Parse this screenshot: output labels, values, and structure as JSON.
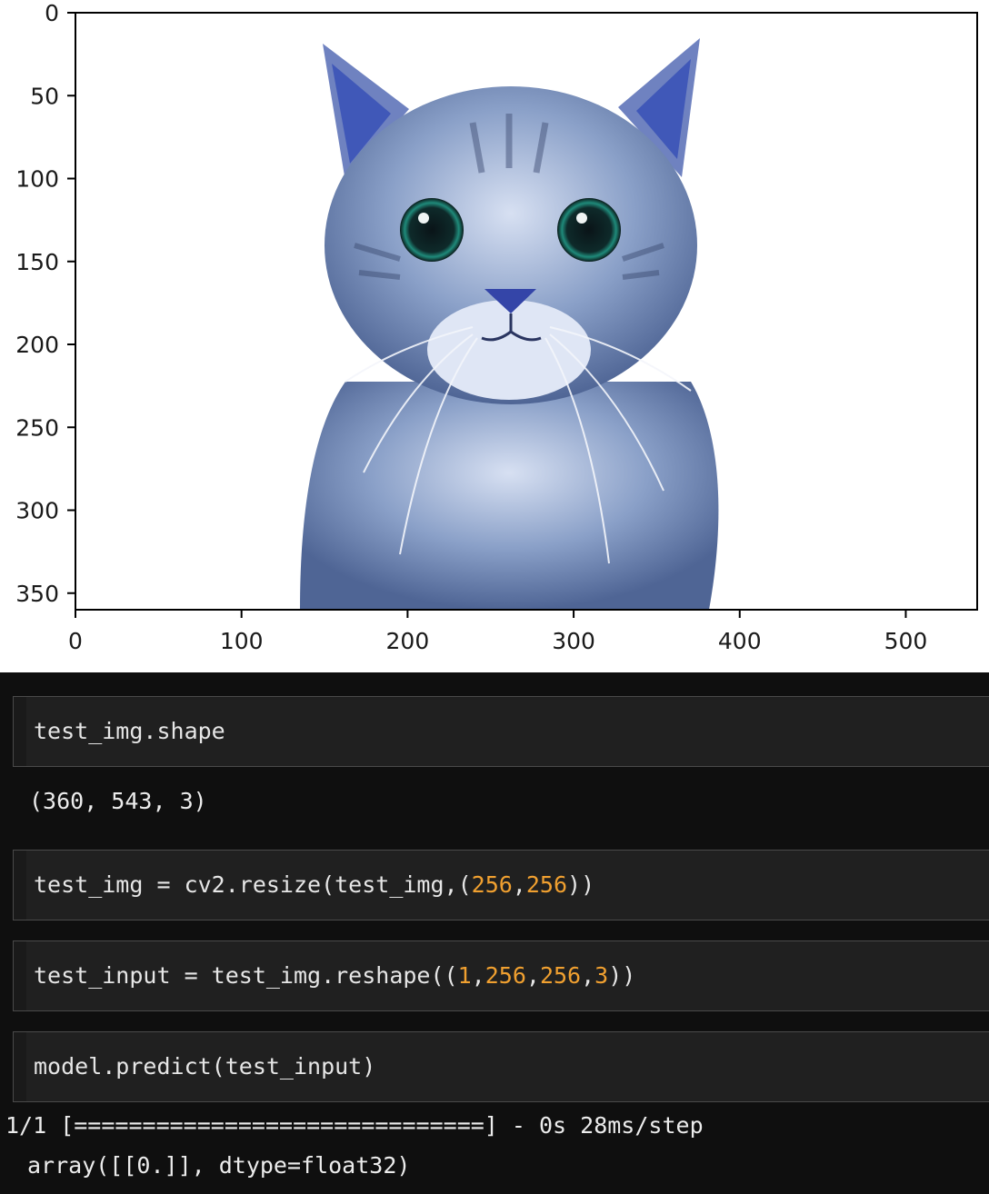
{
  "plot": {
    "x_ticks": [
      "0",
      "100",
      "200",
      "300",
      "400",
      "500"
    ],
    "y_ticks": [
      "0",
      "50",
      "100",
      "150",
      "200",
      "250",
      "300",
      "350"
    ],
    "image_subject": "cat photograph"
  },
  "colors": {
    "notebook_bg": "#0f0f0f",
    "cell_bg": "#202020",
    "number_literal": "#f0a030"
  },
  "cells": [
    {
      "segments": [
        {
          "text": "test_img.shape",
          "type": "text"
        }
      ]
    },
    {
      "segments": [
        {
          "text": "test_img = cv2.resize(test_img,(",
          "type": "text"
        },
        {
          "text": "256",
          "type": "num"
        },
        {
          "text": ",",
          "type": "text"
        },
        {
          "text": "256",
          "type": "num"
        },
        {
          "text": "))",
          "type": "text"
        }
      ]
    },
    {
      "segments": [
        {
          "text": "test_input = test_img.reshape((",
          "type": "text"
        },
        {
          "text": "1",
          "type": "num"
        },
        {
          "text": ",",
          "type": "text"
        },
        {
          "text": "256",
          "type": "num"
        },
        {
          "text": ",",
          "type": "text"
        },
        {
          "text": "256",
          "type": "num"
        },
        {
          "text": ",",
          "type": "text"
        },
        {
          "text": "3",
          "type": "num"
        },
        {
          "text": "))",
          "type": "text"
        }
      ]
    },
    {
      "segments": [
        {
          "text": "model.predict(test_input)",
          "type": "text"
        }
      ]
    }
  ],
  "outputs": {
    "shape_output": "(360, 543, 3)",
    "progress_line": "1/1 [==============================] - 0s 28ms/step",
    "predict_result": "array([[0.]], dtype=float32)"
  }
}
